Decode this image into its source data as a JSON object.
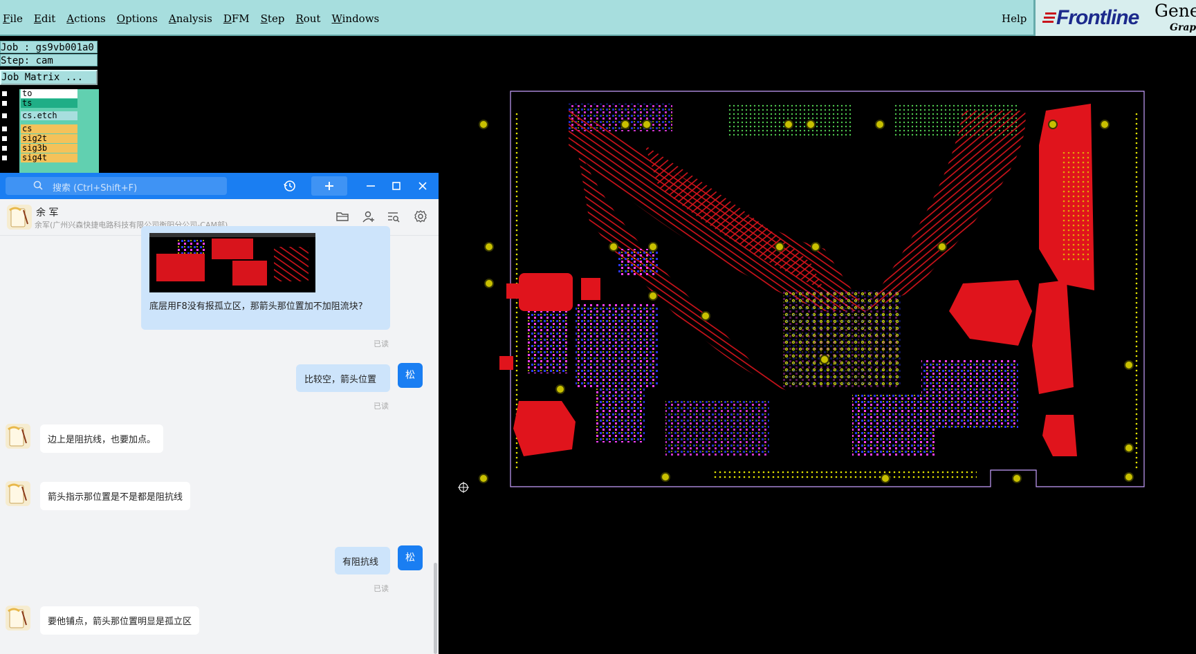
{
  "menubar": {
    "items": [
      "File",
      "Edit",
      "Actions",
      "Options",
      "Analysis",
      "DFM",
      "Step",
      "Rout",
      "Windows"
    ],
    "help": "Help",
    "logo_text": "Frontline",
    "product_text": "Genes",
    "sub_text": "Graph"
  },
  "job_panel": {
    "job": "Job : gs9vb001a0",
    "step": "Step: cam",
    "matrix_button": "Job Matrix ...",
    "layers": [
      {
        "name": "to",
        "color": "#ffffff"
      },
      {
        "name": "ts",
        "color": "#1fae86"
      },
      {
        "name": "cs.etch",
        "color": "#a7dede"
      },
      {
        "name": "cs",
        "color": "#f4c25a"
      },
      {
        "name": "sig2t",
        "color": "#f4c25a"
      },
      {
        "name": "sig3b",
        "color": "#f4c25a"
      },
      {
        "name": "sig4t",
        "color": "#f4c25a"
      }
    ]
  },
  "chat": {
    "search_placeholder": "搜索 (Ctrl+Shift+F)",
    "contact_name": "余 军",
    "contact_org": "余军(广州兴森快捷电路科技有限公司衡阳分公司-CAM部)",
    "me_avatar_text": "松",
    "messages": [
      {
        "from": "me",
        "text": "底层用F8没有报孤立区，那箭头那位置加不加阻流块?",
        "read": "已读",
        "has_image": true
      },
      {
        "from": "me",
        "text": "比较空，箭头位置",
        "read": "已读"
      },
      {
        "from": "them",
        "text": "边上是阻抗线，也要加点。"
      },
      {
        "from": "them",
        "text": "箭头指示那位置是不是都是阻抗线"
      },
      {
        "from": "me",
        "text": "有阻抗线",
        "read": "已读"
      },
      {
        "from": "them",
        "text": "要他铺点，箭头那位置明显是孤立区"
      }
    ]
  },
  "colors": {
    "genesis_bar": "#a7dede",
    "chat_blue": "#1a7ef2",
    "copper": "#e0141c",
    "board_outline": "#c8a0ff"
  }
}
